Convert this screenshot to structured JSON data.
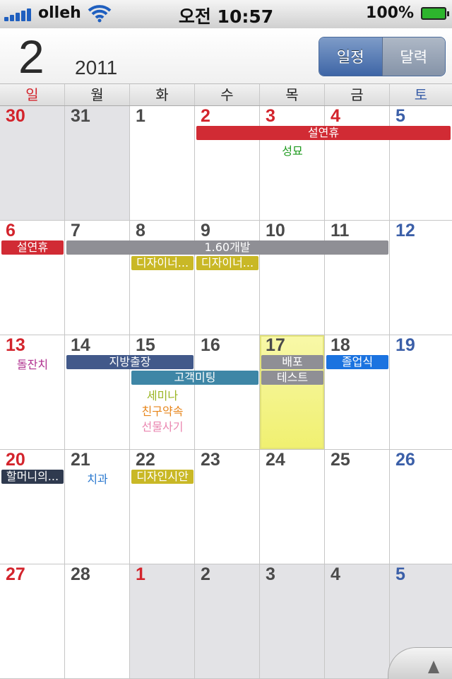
{
  "status": {
    "carrier": "olleh",
    "time": "오전 10:57",
    "battery": "100%"
  },
  "header": {
    "month": "2",
    "year": "2011",
    "views": [
      "일정",
      "달력"
    ],
    "active_view": 0
  },
  "weekdays": [
    "일",
    "월",
    "화",
    "수",
    "목",
    "금",
    "토"
  ],
  "colors": {
    "sunday": "#d3242c",
    "saturday": "#3b5fa8",
    "weekday": "#4a4a4a",
    "today": "#f4f48a",
    "other_month": "#e3e3e6"
  },
  "weeks": [
    [
      {
        "d": "30",
        "other": true
      },
      {
        "d": "31",
        "other": true
      },
      {
        "d": "1"
      },
      {
        "d": "2",
        "holiday": true
      },
      {
        "d": "3",
        "holiday": true
      },
      {
        "d": "4",
        "holiday": true
      },
      {
        "d": "5"
      }
    ],
    [
      {
        "d": "6"
      },
      {
        "d": "7"
      },
      {
        "d": "8"
      },
      {
        "d": "9"
      },
      {
        "d": "10"
      },
      {
        "d": "11"
      },
      {
        "d": "12"
      }
    ],
    [
      {
        "d": "13"
      },
      {
        "d": "14"
      },
      {
        "d": "15"
      },
      {
        "d": "16"
      },
      {
        "d": "17",
        "today": true
      },
      {
        "d": "18"
      },
      {
        "d": "19"
      }
    ],
    [
      {
        "d": "20"
      },
      {
        "d": "21"
      },
      {
        "d": "22"
      },
      {
        "d": "23"
      },
      {
        "d": "24"
      },
      {
        "d": "25"
      },
      {
        "d": "26"
      }
    ],
    [
      {
        "d": "27"
      },
      {
        "d": "28"
      },
      {
        "d": "1",
        "other": true,
        "holiday": true
      },
      {
        "d": "2",
        "other": true
      },
      {
        "d": "3",
        "other": true
      },
      {
        "d": "4",
        "other": true
      },
      {
        "d": "5",
        "other": true
      }
    ]
  ],
  "events": [
    {
      "week": 0,
      "start": 3,
      "span": 5,
      "lane": 0,
      "title": "설연휴",
      "bg": "#d12b34",
      "bar": true
    },
    {
      "week": 0,
      "start": 4,
      "span": 1,
      "lane": 1,
      "title": "성묘",
      "color": "#1e9a1e",
      "bar": false
    },
    {
      "week": 1,
      "start": 0,
      "span": 1,
      "lane": 0,
      "title": "설연휴",
      "bg": "#d12b34",
      "bar": true
    },
    {
      "week": 1,
      "start": 1,
      "span": 5,
      "lane": 0,
      "title": "1.60개발",
      "bg": "#8f8f95",
      "bar": true
    },
    {
      "week": 1,
      "start": 2,
      "span": 1,
      "lane": 1,
      "title": "디자이너...",
      "bg": "#c9b826",
      "bar": true
    },
    {
      "week": 1,
      "start": 3,
      "span": 1,
      "lane": 1,
      "title": "디자이너...",
      "bg": "#c9b826",
      "bar": true
    },
    {
      "week": 2,
      "start": 0,
      "span": 1,
      "lane": 0,
      "title": "돌잔치",
      "color": "#b0308f",
      "bar": false
    },
    {
      "week": 2,
      "start": 1,
      "span": 2,
      "lane": 0,
      "title": "지방출장",
      "bg": "#42598a",
      "bar": true
    },
    {
      "week": 2,
      "start": 4,
      "span": 1,
      "lane": 0,
      "title": "배포",
      "bg": "#8f8f95",
      "bar": true
    },
    {
      "week": 2,
      "start": 5,
      "span": 1,
      "lane": 0,
      "title": "졸업식",
      "bg": "#1b73e0",
      "bar": true
    },
    {
      "week": 2,
      "start": 2,
      "span": 2,
      "lane": 1,
      "title": "고객미팅",
      "bg": "#3e86a6",
      "bar": true
    },
    {
      "week": 2,
      "start": 4,
      "span": 1,
      "lane": 1,
      "title": "테스트",
      "bg": "#8f8f95",
      "bar": true
    },
    {
      "week": 2,
      "start": 2,
      "span": 1,
      "lane": 2,
      "title": "세미나",
      "color": "#9ab522",
      "bar": false
    },
    {
      "week": 2,
      "start": 2,
      "span": 1,
      "lane": 3,
      "title": "친구약속",
      "color": "#e7861b",
      "bar": false
    },
    {
      "week": 2,
      "start": 2,
      "span": 1,
      "lane": 4,
      "title": "선물사기",
      "color": "#ea86b0",
      "bar": false
    },
    {
      "week": 3,
      "start": 0,
      "span": 1,
      "lane": 0,
      "title": "할머니의...",
      "bg": "#2f3a4f",
      "bar": true
    },
    {
      "week": 3,
      "start": 1,
      "span": 1,
      "lane": 0,
      "title": "치과",
      "color": "#2a78cf",
      "bar": false
    },
    {
      "week": 3,
      "start": 2,
      "span": 1,
      "lane": 0,
      "title": "디자인시안",
      "bg": "#c9b826",
      "bar": true
    }
  ]
}
